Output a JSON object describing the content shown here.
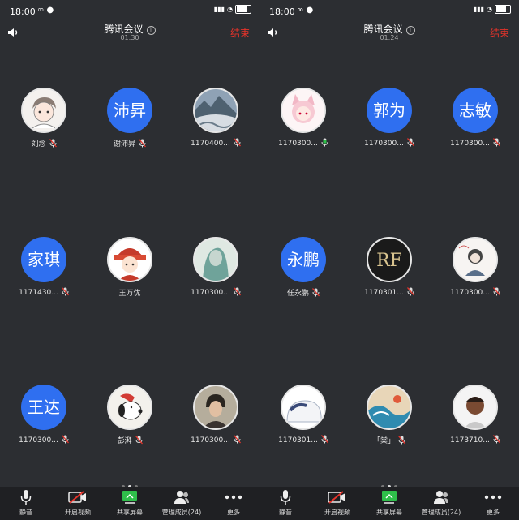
{
  "panels": [
    {
      "status_time": "18:00",
      "title": "腾讯会议",
      "timer": "01:30",
      "end_label": "结束",
      "participants": [
        {
          "name": "刘念",
          "initials": "",
          "avatar": "drawn-boy",
          "mic": "muted"
        },
        {
          "name": "谢沛昇",
          "initials": "沛昇",
          "avatar": "blue",
          "mic": "muted"
        },
        {
          "name": "1170400...",
          "initials": "",
          "avatar": "landscape",
          "mic": "muted"
        },
        {
          "name": "1171430...",
          "initials": "家琪",
          "avatar": "blue",
          "mic": "muted"
        },
        {
          "name": "王万优",
          "initials": "",
          "avatar": "cartoon-red",
          "mic": "none"
        },
        {
          "name": "1170300...",
          "initials": "",
          "avatar": "portrait-teal",
          "mic": "muted"
        },
        {
          "name": "1170300...",
          "initials": "王达",
          "avatar": "blue",
          "mic": "muted"
        },
        {
          "name": "彭湃",
          "initials": "",
          "avatar": "snoopy",
          "mic": "muted"
        },
        {
          "name": "1170300...",
          "initials": "",
          "avatar": "portrait-man",
          "mic": "muted"
        }
      ],
      "toolbar": [
        {
          "label": "静音",
          "icon": "microphone-icon"
        },
        {
          "label": "开启视频",
          "icon": "video-off-icon"
        },
        {
          "label": "共享屏幕",
          "icon": "share-screen-icon"
        },
        {
          "label": "管理成员(24)",
          "icon": "members-icon"
        },
        {
          "label": "更多",
          "icon": "more-icon"
        }
      ]
    },
    {
      "status_time": "18:00",
      "title": "腾讯会议",
      "timer": "01:24",
      "end_label": "结束",
      "participants": [
        {
          "name": "1170300...",
          "initials": "",
          "avatar": "anime-pink",
          "mic": "active"
        },
        {
          "name": "1170300...",
          "initials": "郭为",
          "avatar": "blue",
          "mic": "muted"
        },
        {
          "name": "1170300...",
          "initials": "志敏",
          "avatar": "blue",
          "mic": "muted"
        },
        {
          "name": "任永鹏",
          "initials": "永鹏",
          "avatar": "blue",
          "mic": "muted"
        },
        {
          "name": "1170301...",
          "initials": "",
          "avatar": "rf-logo",
          "mic": "muted"
        },
        {
          "name": "1170300...",
          "initials": "",
          "avatar": "sketch-girl",
          "mic": "muted"
        },
        {
          "name": "1170301...",
          "initials": "",
          "avatar": "blob",
          "mic": "muted"
        },
        {
          "name": "「棠」",
          "initials": "",
          "avatar": "wave",
          "mic": "muted"
        },
        {
          "name": "1173710...",
          "initials": "",
          "avatar": "brown-boy",
          "mic": "muted"
        }
      ],
      "toolbar": [
        {
          "label": "静音",
          "icon": "microphone-icon"
        },
        {
          "label": "开启视频",
          "icon": "video-off-icon"
        },
        {
          "label": "共享屏幕",
          "icon": "share-screen-icon"
        },
        {
          "label": "管理成员(24)",
          "icon": "members-icon"
        },
        {
          "label": "更多",
          "icon": "more-icon"
        }
      ]
    }
  ],
  "colors": {
    "accent_blue": "#2f6ff0",
    "end_red": "#e8332a",
    "mic_muted": "#e8332a",
    "mic_active": "#2fbf4a"
  }
}
